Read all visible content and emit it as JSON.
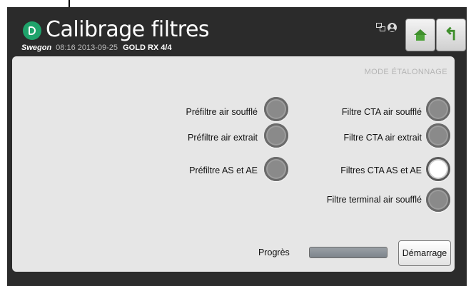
{
  "header": {
    "title": "Calibrage filtres",
    "brand": "Swegon",
    "time": "08:16",
    "date": "2013-09-25",
    "model": "GOLD RX 4/4",
    "icons": [
      "network-icon",
      "user-icon"
    ],
    "buttons": [
      "home-icon",
      "back-arrow-icon"
    ]
  },
  "panel": {
    "mode_label": "MODE ÉTALONNAGE",
    "left_filters": [
      {
        "label": "Préfiltre air soufflé",
        "active": false
      },
      {
        "label": "Préfiltre air extrait",
        "active": false
      },
      {
        "label": "Préfiltre AS et AE",
        "active": false
      }
    ],
    "right_filters": [
      {
        "label": "Filtre CTA air soufflé",
        "active": false
      },
      {
        "label": "Filtre CTA air extrait",
        "active": false
      },
      {
        "label": "Filtres CTA AS et AE",
        "active": true
      },
      {
        "label": "Filtre terminal air soufflé",
        "active": false
      }
    ],
    "progress_label": "Progrès",
    "progress_value": 0,
    "start_label": "Démarrage"
  },
  "colors": {
    "accent": "#1fa36b",
    "home": "#3f8f2c",
    "background": "#2b2b2b",
    "panel": "#e6e6e6"
  }
}
